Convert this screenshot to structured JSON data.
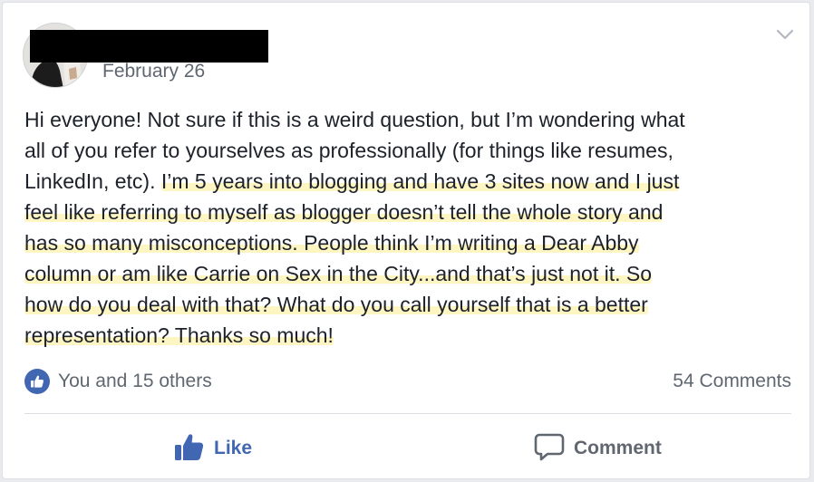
{
  "post": {
    "date": "February 26",
    "text_lines": [
      {
        "plain": "Hi everyone! Not sure if this is a weird question, but I’m wondering what",
        "highlight": ""
      },
      {
        "plain": "all of you refer to yourselves as professionally (for things like resumes,",
        "highlight": ""
      },
      {
        "plain": "LinkedIn, etc). ",
        "highlight": "I’m 5 years into blogging and have 3 sites now and I just"
      },
      {
        "plain": "",
        "highlight": "feel like referring to myself as blogger doesn’t tell the whole story and"
      },
      {
        "plain": "",
        "highlight": "has so many misconceptions. People think I’m writing a Dear Abby"
      },
      {
        "plain": "",
        "highlight": "column or am like Carrie on Sex in the City...and that’s just not it. So"
      },
      {
        "plain": "",
        "highlight": "how do you deal with that? What do you call yourself that is a better"
      },
      {
        "plain": "",
        "highlight": "representation? Thanks so much!"
      }
    ]
  },
  "reactions": {
    "summary": "You and 15 others",
    "comments": "54 Comments"
  },
  "actions": {
    "like": "Like",
    "comment": "Comment"
  },
  "icons": {
    "menu": "chevron-down-icon",
    "reaction": "thumbs-up-icon",
    "like": "thumbs-up-icon",
    "comment": "speech-bubble-icon"
  },
  "colors": {
    "accent": "#4267b2",
    "secondary_text": "#606770",
    "highlight": "#fdf5c2"
  }
}
